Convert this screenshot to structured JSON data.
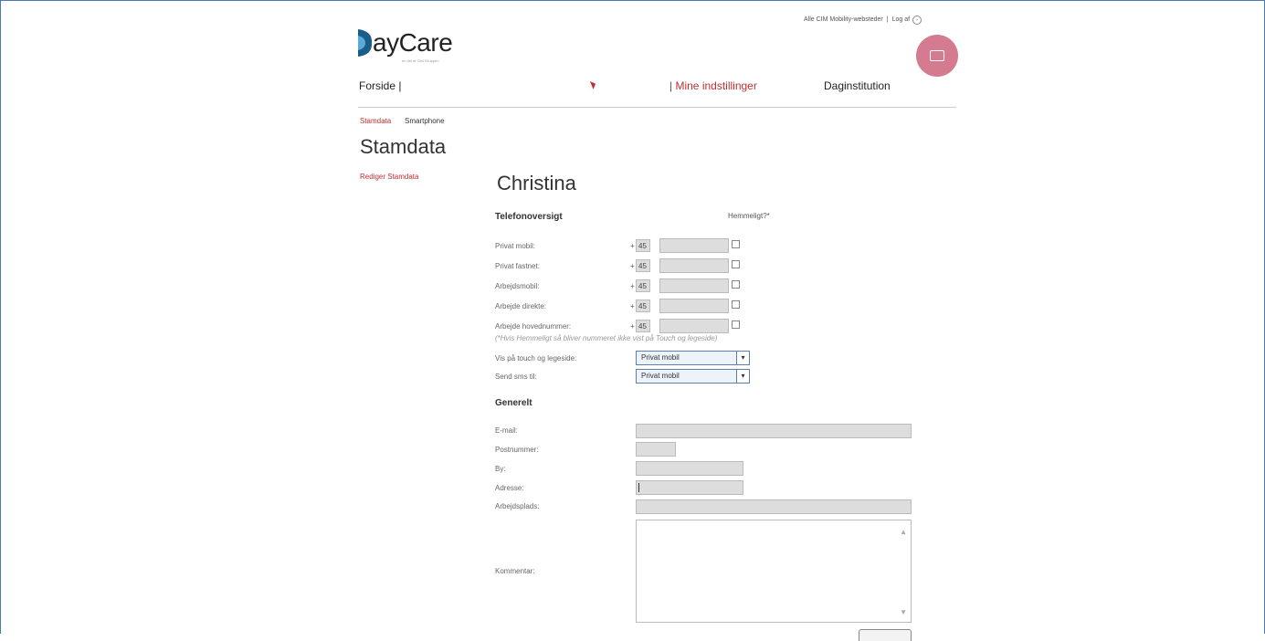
{
  "top_links": {
    "all_sites": "Alle CIM Mobility-websteder",
    "separator": "|",
    "logout": "Log af"
  },
  "logo": {
    "text": "ayCare",
    "tagline": "en del af CIM Gruppen"
  },
  "nav": {
    "home": "Forside",
    "home_sep": "|",
    "settings_sep": "|",
    "settings": "Mine indstillinger",
    "institution": "Daginstitution"
  },
  "breadcrumb": {
    "stamdata": "Stamdata",
    "smartphone": "Smartphone"
  },
  "page_title": "Stamdata",
  "sidebar": {
    "edit_link": "Rediger Stamdata"
  },
  "person_name": "Christina",
  "phone_section": {
    "title": "Telefonoversigt",
    "secret_header": "Hemmeligt?*",
    "rows": [
      {
        "label": "Privat mobil:",
        "prefix": "+",
        "country_code": "45"
      },
      {
        "label": "Privat fastnet:",
        "prefix": "+",
        "country_code": "45"
      },
      {
        "label": "Arbejdsmobil:",
        "prefix": "+",
        "country_code": "45"
      },
      {
        "label": "Arbejde direkte:",
        "prefix": "+",
        "country_code": "45"
      },
      {
        "label": "Arbejde hovednummer:",
        "prefix": "+",
        "country_code": "45"
      }
    ],
    "note": "(*Hvis Hemmeligt så bliver nummeret ikke vist på Touch og legeside)"
  },
  "display_on_touch": {
    "label": "Vis på touch og legeside:",
    "value": "Privat mobil"
  },
  "send_sms_to": {
    "label": "Send sms til:",
    "value": "Privat mobil"
  },
  "general_section": {
    "title": "Generelt",
    "email_label": "E-mail:",
    "postal_label": "Postnummer:",
    "city_label": "By:",
    "address_label": "Adresse:",
    "workplace_label": "Arbejdsplads:",
    "comment_label": "Kommentar:"
  },
  "colors": {
    "accent_red": "#c03030",
    "avatar_pink": "#d47b8f",
    "frame_blue": "#4a7ab5"
  }
}
